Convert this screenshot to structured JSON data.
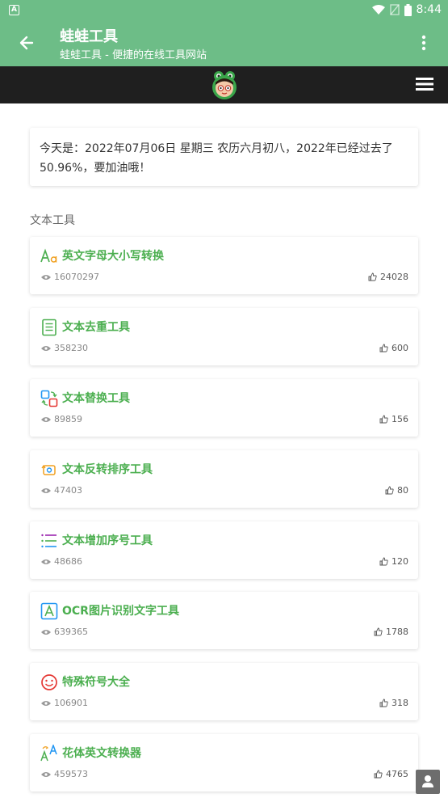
{
  "status_bar": {
    "time": "8:44",
    "left_icon_letter": "A"
  },
  "app_bar": {
    "title": "蛙蛙工具",
    "subtitle": "蛙蛙工具 - 便捷的在线工具网站"
  },
  "date_notice": {
    "text": "今天是：2022年07月06日 星期三 农历六月初八，2022年已经过去了50.96%，要加油哦！"
  },
  "section": {
    "title": "文本工具"
  },
  "tools": [
    {
      "name": "英文字母大小写转换",
      "views": "16070297",
      "likes": "24028",
      "icon": "text-case-icon"
    },
    {
      "name": "文本去重工具",
      "views": "358230",
      "likes": "600",
      "icon": "document-icon"
    },
    {
      "name": "文本替换工具",
      "views": "89859",
      "likes": "156",
      "icon": "replace-icon"
    },
    {
      "name": "文本反转排序工具",
      "views": "47403",
      "likes": "80",
      "icon": "reverse-icon"
    },
    {
      "name": "文本增加序号工具",
      "views": "48686",
      "likes": "120",
      "icon": "numbered-list-icon"
    },
    {
      "name": "OCR图片识别文字工具",
      "views": "639365",
      "likes": "1788",
      "icon": "ocr-icon"
    },
    {
      "name": "特殊符号大全",
      "views": "106901",
      "likes": "318",
      "icon": "smiley-icon"
    },
    {
      "name": "花体英文转换器",
      "views": "459573",
      "likes": "4765",
      "icon": "fancy-text-icon"
    }
  ],
  "colors": {
    "primary": "#6dbd87",
    "accent": "#4caf50",
    "navbar": "#1f1f1f"
  }
}
